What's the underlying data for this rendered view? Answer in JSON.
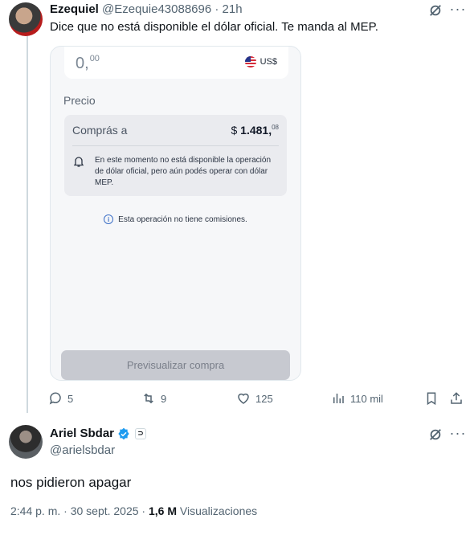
{
  "tweet1": {
    "name": "Ezequiel",
    "handle": "@Ezequie43088696",
    "separator": "·",
    "time": "21h",
    "text": "Dice que no está disponible el dólar oficial. Te manda al MEP.",
    "media": {
      "amount_int": "0,",
      "amount_dec": "00",
      "currency": "US$",
      "precio_label": "Precio",
      "compras_label": "Comprás a",
      "price_symbol": "$ ",
      "price_int": "1.481,",
      "price_dec": "08",
      "notice": "En este momento no está disponible la operación de dólar oficial, pero aún podés operar con dólar MEP.",
      "info_icon": "i",
      "info_text": "Esta operación no tiene comisiones.",
      "button_label": "Previsualizar compra"
    },
    "actions": {
      "replies": "5",
      "retweets": "9",
      "likes": "125",
      "views": "110 mil"
    }
  },
  "tweet2": {
    "name": "Ariel Sbdar",
    "handle": "@arielsbdar",
    "affiliate_glyph": "⊃",
    "text": "nos pidieron apagar",
    "meta_prefix": "2:44 p. m. · 30 sept. 2025 · ",
    "views_count": "1,6 M",
    "views_label": " Visualizaciones"
  },
  "icons": {
    "more": "···",
    "grok": "grok-icon",
    "reply": "reply-icon",
    "retweet": "retweet-icon",
    "like": "heart-icon",
    "views": "views-icon",
    "bookmark": "bookmark-icon",
    "share": "share-icon",
    "bell": "bell-icon",
    "verified": "verified-badge-icon"
  },
  "colors": {
    "muted": "#536471",
    "verified_blue": "#1d9bf0",
    "thread_line": "#cfd9de"
  }
}
